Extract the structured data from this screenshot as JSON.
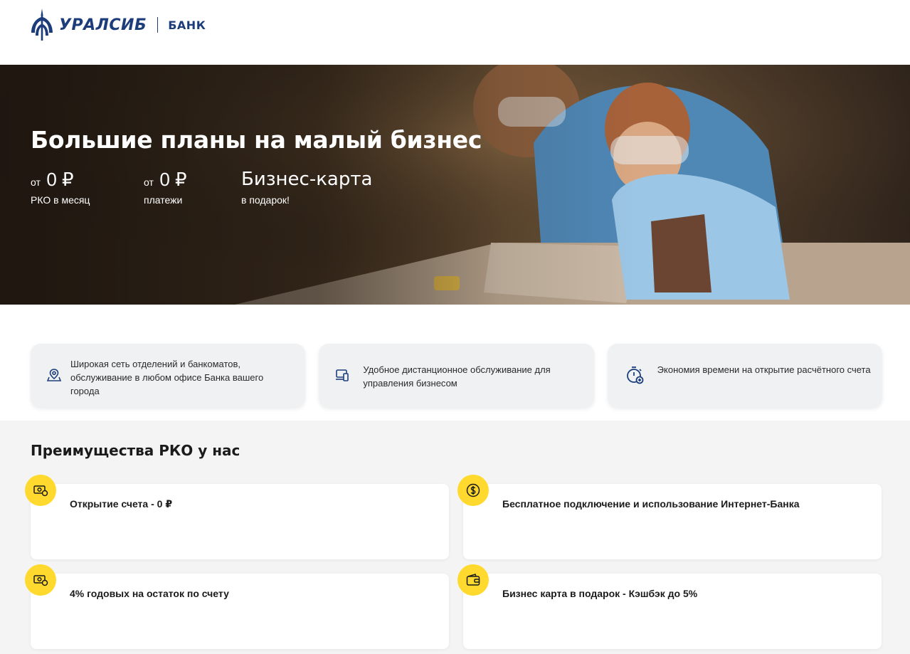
{
  "header": {
    "brand": "УРАЛСИБ",
    "bank_label": "БАНК"
  },
  "hero": {
    "title": "Большие планы на малый бизнес",
    "stats": [
      {
        "prefix": "от",
        "value": "0 ₽",
        "caption": "РКО в месяц"
      },
      {
        "prefix": "от",
        "value": "0 ₽",
        "caption": "платежи"
      },
      {
        "prefix": "",
        "value": "Бизнес-карта",
        "caption": "в подарок!"
      }
    ]
  },
  "features": [
    {
      "icon": "map-pin-icon",
      "text": "Широкая сеть отделений и банкоматов, обслуживание в любом офисе Банка вашего города"
    },
    {
      "icon": "laptop-phone-icon",
      "text": "Удобное дистанционное обслуживание для управления бизнесом"
    },
    {
      "icon": "stopwatch-icon",
      "text": "Экономия времени на открытие расчётного счета"
    }
  ],
  "advantages": {
    "title": "Преимущества РКО у нас",
    "items": [
      {
        "icon": "cash-coin-icon",
        "text": "Открытие счета - 0 ₽"
      },
      {
        "icon": "dollar-coin-icon",
        "text": "Бесплатное подключение и использование Интернет-Банка"
      },
      {
        "icon": "cash-coin-icon",
        "text": "4% годовых на остаток по счету"
      },
      {
        "icon": "wallet-icon",
        "text": "Бизнес карта в подарок - Кэшбэк до 5%"
      }
    ]
  },
  "colors": {
    "brand_blue": "#1c3d7a",
    "accent_yellow": "#ffd92e",
    "icon_blue": "#1d3f7c"
  }
}
